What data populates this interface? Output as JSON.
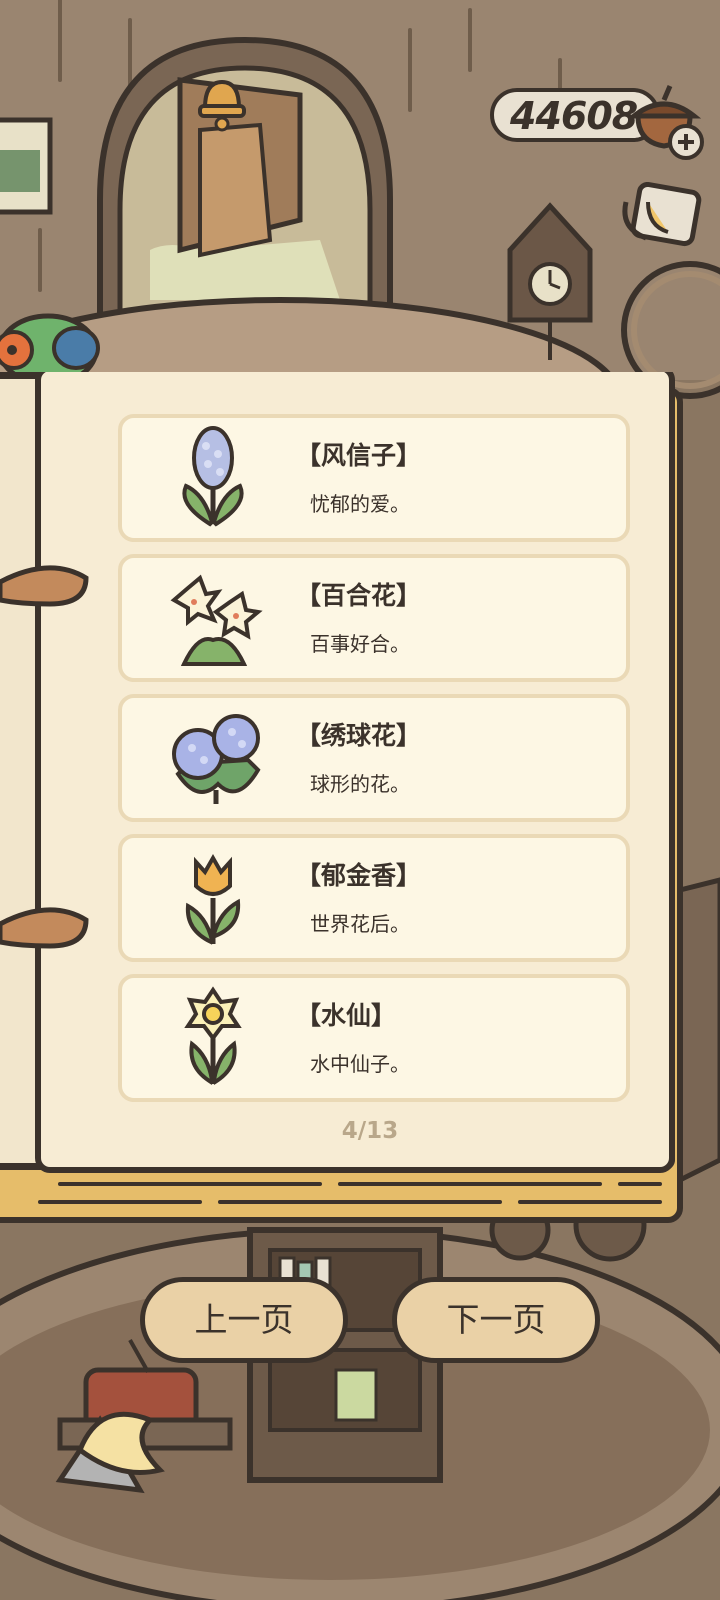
{
  "currency": {
    "coins": "44608"
  },
  "flower_book": {
    "entries": [
      {
        "name": "【风信子】",
        "description": "忧郁的爱。",
        "icon": "hyacinth-icon"
      },
      {
        "name": "【百合花】",
        "description": "百事好合。",
        "icon": "lily-icon"
      },
      {
        "name": "【绣球花】",
        "description": "球形的花。",
        "icon": "hydrangea-icon"
      },
      {
        "name": "【郁金香】",
        "description": "世界花后。",
        "icon": "tulip-icon"
      },
      {
        "name": "【水仙】",
        "description": "水中仙子。",
        "icon": "daffodil-icon"
      }
    ],
    "page_indicator": "4/13"
  },
  "navigation": {
    "prev_label": "上一页",
    "next_label": "下一页"
  },
  "colors": {
    "outline": "#3b322b",
    "page": "#f7ecd4",
    "entry_card": "#fdf7e4",
    "button": "#ead1a6",
    "wood": "#8a7661"
  }
}
